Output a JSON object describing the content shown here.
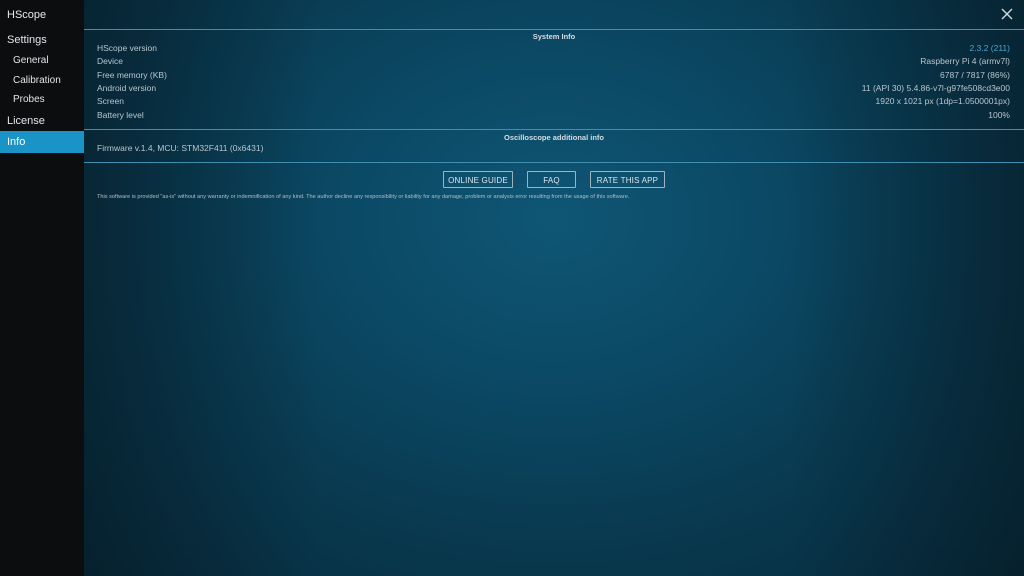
{
  "app": {
    "title": "HScope"
  },
  "sidebar": {
    "items": [
      {
        "label": "Settings"
      },
      {
        "label": "General"
      },
      {
        "label": "Calibration"
      },
      {
        "label": "Probes"
      },
      {
        "label": "License"
      },
      {
        "label": "Info"
      }
    ],
    "active": "Info"
  },
  "system_info": {
    "title": "System Info",
    "rows": [
      {
        "label": "HScope version",
        "value": "2.3.2 (211)"
      },
      {
        "label": "Device",
        "value": "Raspberry Pi 4 (armv7l)"
      },
      {
        "label": "Free memory (KB)",
        "value": "6787 / 7817 (86%)"
      },
      {
        "label": "Android version",
        "value": "11 (API 30) 5.4.86-v7l-g97fe508cd3e00"
      },
      {
        "label": "Screen",
        "value": "1920 x 1021 px (1dp=1.0500001px)"
      },
      {
        "label": "Battery level",
        "value": "100%"
      }
    ]
  },
  "oscilloscope_info": {
    "title": "Oscilloscope additional info",
    "firmware": "Firmware v.1.4, MCU: STM32F411 (0x6431)"
  },
  "buttons": {
    "online_guide": "ONLINE GUIDE",
    "faq": "FAQ",
    "rate": "RATE THIS APP"
  },
  "disclaimer": "This software is provided \"as-is\" without any warranty or indemnification of any kind. The author decline any responsibility or liability for any damage, problem or analysis error resulting from the usage of this software.",
  "colors": {
    "accent": "#1a93c7",
    "link": "#4aa6d2",
    "background": "#0a4360"
  },
  "icons": {
    "close": "close-icon"
  }
}
